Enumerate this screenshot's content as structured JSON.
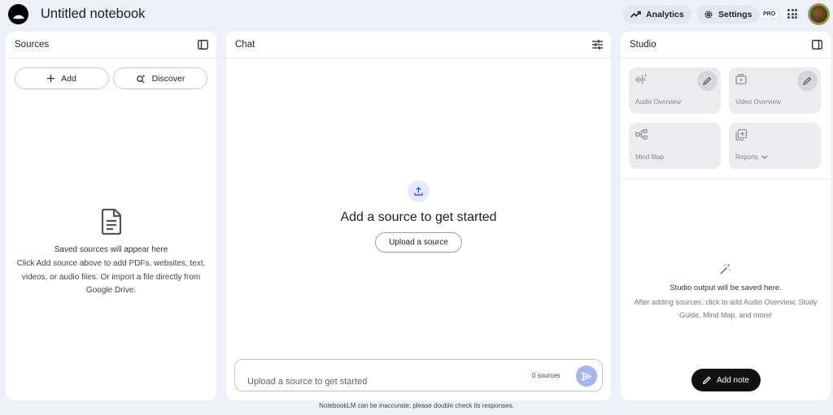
{
  "header": {
    "title": "Untitled notebook",
    "analytics_label": "Analytics",
    "settings_label": "Settings",
    "pro_badge": "PRO"
  },
  "sources": {
    "title": "Sources",
    "add_label": "Add",
    "discover_label": "Discover",
    "empty_heading": "Saved sources will appear here",
    "empty_text": "Click Add source above to add PDFs, websites, text, videos, or audio files. Or import a file directly from Google Drive."
  },
  "chat": {
    "title": "Chat",
    "empty_heading": "Add a source to get started",
    "upload_label": "Upload a source",
    "input_placeholder": "Upload a source to get started",
    "source_count": "0 sources"
  },
  "studio": {
    "title": "Studio",
    "tiles": [
      {
        "label": "Audio Overview",
        "icon": "audio-wave-icon"
      },
      {
        "label": "Video Overview",
        "icon": "video-icon"
      },
      {
        "label": "Mind Map",
        "icon": "mind-map-icon"
      },
      {
        "label": "Reports",
        "icon": "reports-icon"
      }
    ],
    "empty_heading": "Studio output will be saved here.",
    "empty_text": "After adding sources, click to add Audio Overview, Study Guide, Mind Map, and more!",
    "add_note_label": "Add note"
  },
  "footer": {
    "disclaimer": "NotebookLM can be inaccurate; please double check its responses."
  },
  "colors": {
    "page_bg": "#eef0f8",
    "panel_bg": "#ffffff",
    "tile_bg": "#ececee",
    "send_button": "#a8b4f0",
    "add_note_bg": "#111111"
  }
}
